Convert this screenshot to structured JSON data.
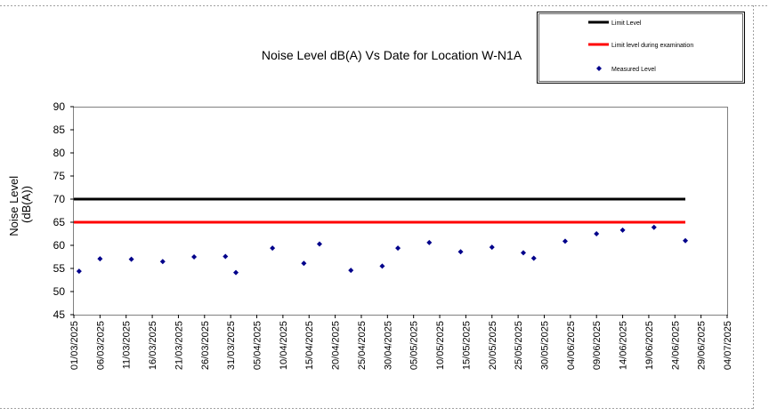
{
  "chart_data": {
    "type": "scatter",
    "title": "Noise Level dB(A) Vs Date for Location W-N1A",
    "ylabel_line1": "Noise Level",
    "ylabel_line2": "(dB(A))",
    "xlabel": "",
    "x_range": [
      "01/03/2025",
      "04/07/2025"
    ],
    "ylim": [
      45,
      90
    ],
    "ytick_step": 5,
    "yticks": [
      "45",
      "50",
      "55",
      "60",
      "65",
      "70",
      "75",
      "80",
      "85",
      "90"
    ],
    "xticks": [
      "01/03/2025",
      "06/03/2025",
      "11/03/2025",
      "16/03/2025",
      "21/03/2025",
      "26/03/2025",
      "31/03/2025",
      "05/04/2025",
      "10/04/2025",
      "15/04/2025",
      "20/04/2025",
      "25/04/2025",
      "30/04/2025",
      "05/05/2025",
      "10/05/2025",
      "15/05/2025",
      "20/05/2025",
      "25/05/2025",
      "30/05/2025",
      "04/06/2025",
      "09/06/2025",
      "14/06/2025",
      "19/06/2025",
      "24/06/2025",
      "29/06/2025",
      "04/07/2025"
    ],
    "grid": false,
    "legend_position": "top-right",
    "series": [
      {
        "name": "Limit Level",
        "kind": "line",
        "color": "#000000",
        "points": [
          {
            "x": "01/03/2025",
            "y": 70
          },
          {
            "x": "26/06/2025",
            "y": 70
          }
        ]
      },
      {
        "name": "Limit level during examination",
        "kind": "line",
        "color": "#ff0000",
        "points": [
          {
            "x": "01/03/2025",
            "y": 65
          },
          {
            "x": "26/06/2025",
            "y": 65
          }
        ]
      },
      {
        "name": "Measured Level",
        "kind": "scatter",
        "color": "#00008b",
        "points": [
          {
            "x": "02/03/2025",
            "y": 54.4
          },
          {
            "x": "06/03/2025",
            "y": 57.1
          },
          {
            "x": "12/03/2025",
            "y": 57.0
          },
          {
            "x": "18/03/2025",
            "y": 56.5
          },
          {
            "x": "24/03/2025",
            "y": 57.5
          },
          {
            "x": "30/03/2025",
            "y": 57.6
          },
          {
            "x": "01/04/2025",
            "y": 54.1
          },
          {
            "x": "08/04/2025",
            "y": 59.4
          },
          {
            "x": "14/04/2025",
            "y": 56.1
          },
          {
            "x": "17/04/2025",
            "y": 60.3
          },
          {
            "x": "23/04/2025",
            "y": 54.6
          },
          {
            "x": "29/04/2025",
            "y": 55.5
          },
          {
            "x": "02/05/2025",
            "y": 59.4
          },
          {
            "x": "08/05/2025",
            "y": 60.6
          },
          {
            "x": "14/05/2025",
            "y": 58.6
          },
          {
            "x": "20/05/2025",
            "y": 59.6
          },
          {
            "x": "26/05/2025",
            "y": 58.4
          },
          {
            "x": "28/05/2025",
            "y": 57.2
          },
          {
            "x": "03/06/2025",
            "y": 60.9
          },
          {
            "x": "09/06/2025",
            "y": 62.5
          },
          {
            "x": "14/06/2025",
            "y": 63.3
          },
          {
            "x": "20/06/2025",
            "y": 63.9
          },
          {
            "x": "26/06/2025",
            "y": 61.0
          }
        ]
      }
    ]
  }
}
